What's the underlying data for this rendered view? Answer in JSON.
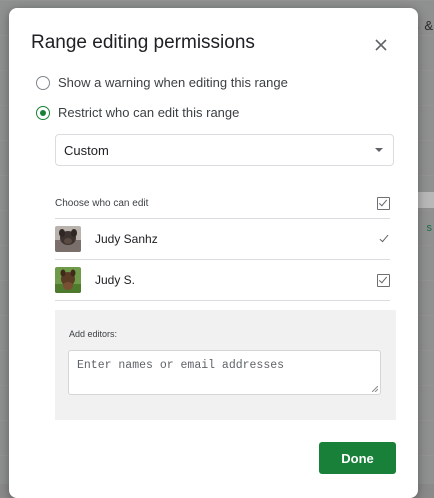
{
  "background": {
    "right_text": "s &",
    "right_green_text": "s"
  },
  "dialog": {
    "title": "Range editing permissions",
    "close_icon": "close-icon",
    "options": [
      {
        "label": "Show a warning when editing this range",
        "checked": false
      },
      {
        "label": "Restrict who can edit this range",
        "checked": true
      }
    ],
    "select": {
      "value": "Custom"
    },
    "choose_header": {
      "label": "Choose who can edit",
      "all_checked": true
    },
    "editors": [
      {
        "name": "Judy Sanhz",
        "avatar": "avatar-photo",
        "checked": true
      },
      {
        "name": "Judy S.",
        "avatar": "avatar-photo",
        "checked": true
      }
    ],
    "add_editors": {
      "label": "Add editors:",
      "placeholder": "Enter names or email addresses",
      "value": ""
    },
    "done_label": "Done"
  },
  "colors": {
    "accent": "#188038",
    "text": "#202124",
    "divider": "#dadce0"
  }
}
